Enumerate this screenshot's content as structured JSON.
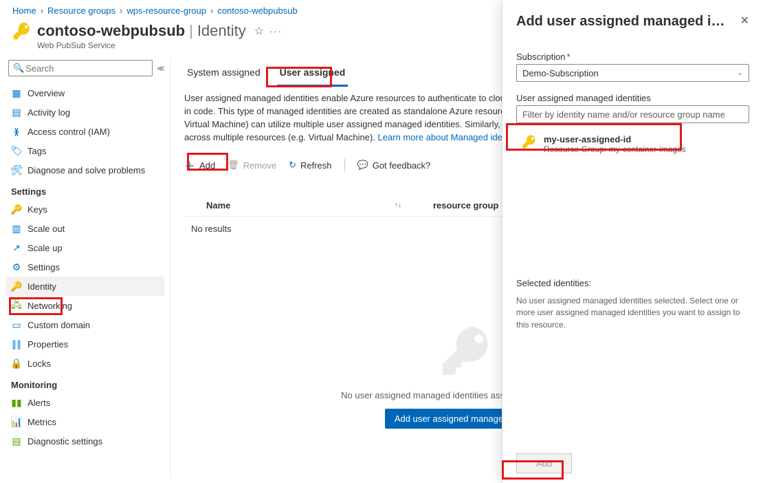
{
  "breadcrumbs": {
    "home": "Home",
    "rg": "Resource groups",
    "group": "wps-resource-group",
    "res": "contoso-webpubsub"
  },
  "header": {
    "name": "contoso-webpubsub",
    "page": "Identity",
    "subtitle": "Web PubSub Service"
  },
  "search_placeholder": "Search",
  "nav": {
    "overview": "Overview",
    "activity": "Activity log",
    "iam": "Access control (IAM)",
    "tags": "Tags",
    "diag": "Diagnose and solve problems",
    "grp_settings": "Settings",
    "keys": "Keys",
    "scaleout": "Scale out",
    "scaleup": "Scale up",
    "settings": "Settings",
    "identity": "Identity",
    "networking": "Networking",
    "custom": "Custom domain",
    "properties": "Properties",
    "locks": "Locks",
    "grp_monitoring": "Monitoring",
    "alerts": "Alerts",
    "metrics": "Metrics",
    "diagset": "Diagnostic settings"
  },
  "tabs": {
    "system": "System assigned",
    "user": "User assigned"
  },
  "desc_text": "User assigned managed identities enable Azure resources to authenticate to cloud services (e.g. Azure Key Vault) without storing credentials in code. This type of managed identities are created as standalone Azure resources, and have their own lifecycle. A single resource (e.g. Virtual Machine) can utilize multiple user assigned managed identities. Similarly, a single user assigned managed identity can be shared across multiple resources (e.g. Virtual Machine). ",
  "desc_link": "Learn more about Managed identities.",
  "toolbar": {
    "add": "Add",
    "remove": "Remove",
    "refresh": "Refresh",
    "feedback": "Got feedback?"
  },
  "table": {
    "name": "Name",
    "rg": "resource group",
    "empty": "No results"
  },
  "empty": {
    "msg": "No user assigned managed identities assigned to this resource.",
    "btn": "Add user assigned managed identity"
  },
  "panel": {
    "title": "Add user assigned managed i…",
    "sub_label": "Subscription",
    "sub_value": "Demo-Subscription",
    "ids_label": "User assigned managed identities",
    "filter_placeholder": "Filter by identity name and/or resource group name",
    "item_name": "my-user-assigned-id",
    "item_sub": "Resource Group: my-container-images",
    "sel_header": "Selected identities:",
    "sel_msg": "No user assigned managed identities selected. Select one or more user assigned managed identities you want to assign to this resource.",
    "add": "Add"
  }
}
